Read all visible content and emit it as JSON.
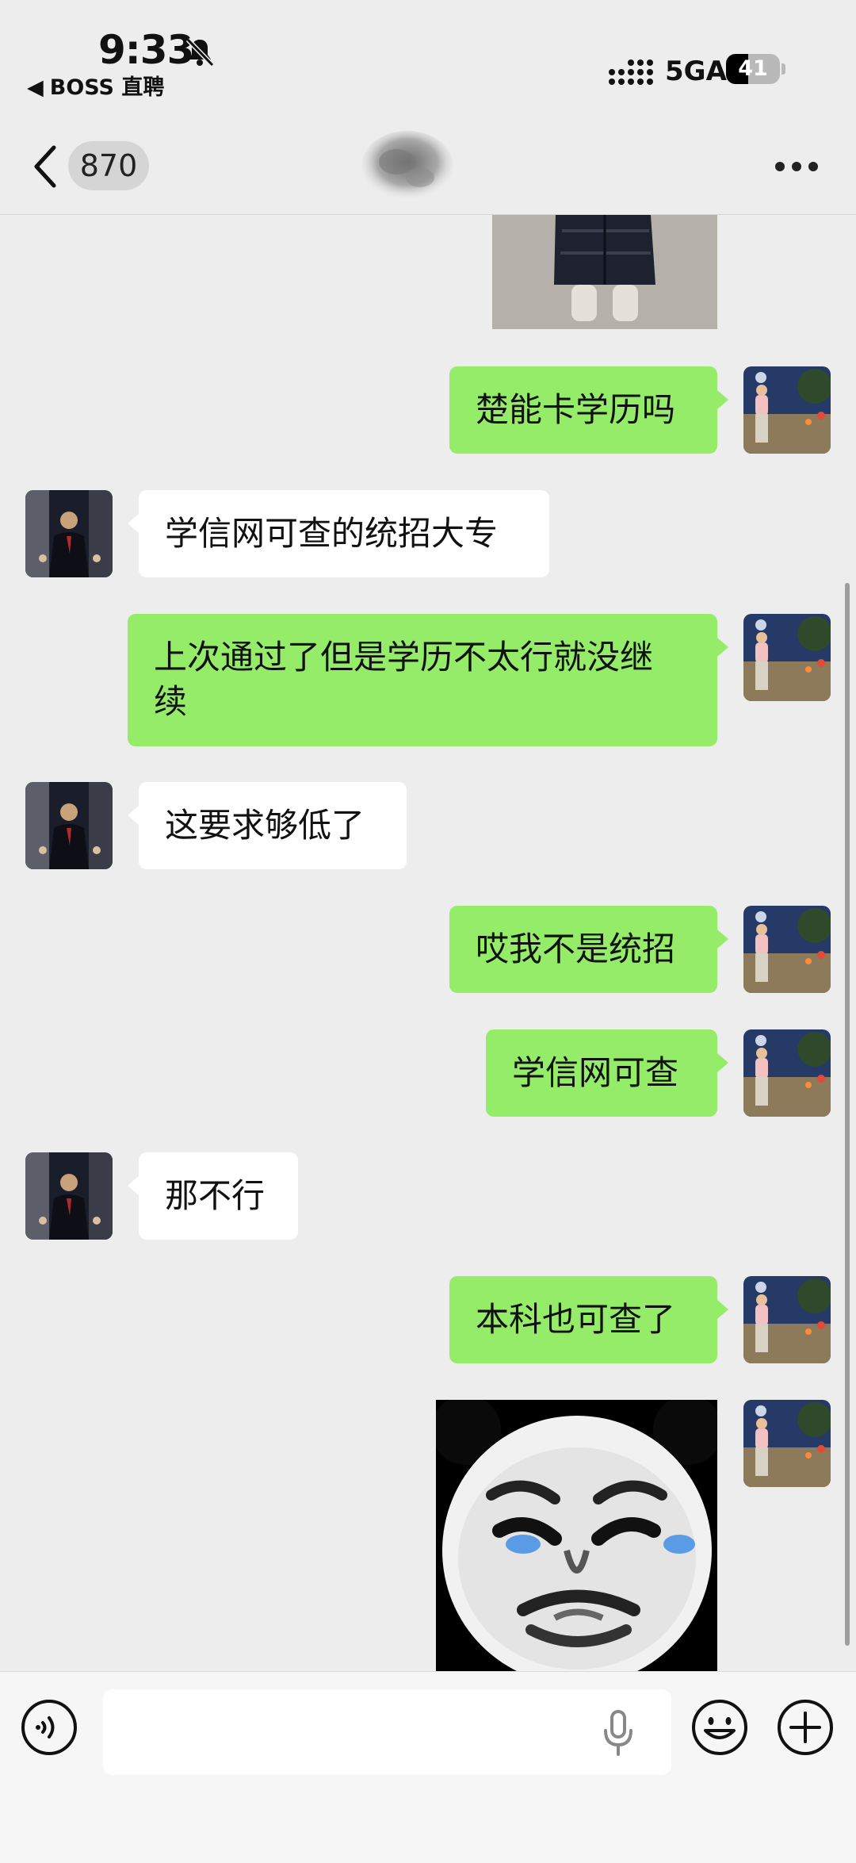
{
  "status_bar": {
    "time": "9:33",
    "back_app": "BOSS 直聘",
    "network": "5GA",
    "battery": "41",
    "battery_level": 0.41,
    "icons": [
      "bell-slash-icon",
      "signal-icon"
    ]
  },
  "nav": {
    "unread_count": "870",
    "icons": [
      "back-chevron-icon",
      "more-dots-icon"
    ]
  },
  "messages": [
    {
      "side": "out",
      "type": "image",
      "content": "partial-photo-jacket"
    },
    {
      "side": "out",
      "type": "text",
      "text": "楚能卡学历吗"
    },
    {
      "side": "in",
      "type": "text",
      "text": "学信网可查的统招大专"
    },
    {
      "side": "out",
      "type": "text",
      "text": "上次通过了但是学历不太行就没继\n续"
    },
    {
      "side": "in",
      "type": "text",
      "text": "这要求够低了"
    },
    {
      "side": "out",
      "type": "text",
      "text": "哎我不是统招"
    },
    {
      "side": "out",
      "type": "text",
      "text": "学信网可查"
    },
    {
      "side": "in",
      "type": "text",
      "text": "那不行"
    },
    {
      "side": "out",
      "type": "text",
      "text": "本科也可查了"
    },
    {
      "side": "out",
      "type": "image",
      "content": "panda-face-sticker"
    }
  ],
  "input_bar": {
    "placeholder": "",
    "icons": [
      "voice-icon",
      "microphone-icon",
      "emoji-icon",
      "plus-icon"
    ]
  },
  "colors": {
    "background": "#ededed",
    "outgoing_bubble": "#95ec69",
    "incoming_bubble": "#ffffff"
  }
}
